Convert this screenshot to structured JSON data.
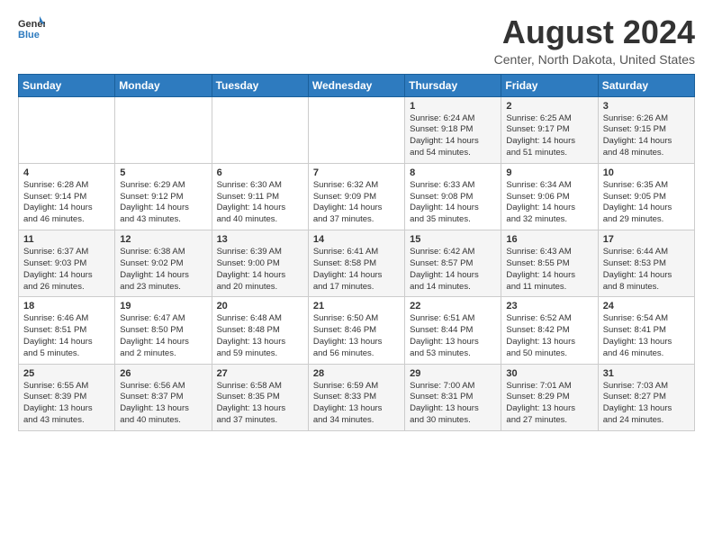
{
  "header": {
    "logo_general": "General",
    "logo_blue": "Blue",
    "month_year": "August 2024",
    "location": "Center, North Dakota, United States"
  },
  "days_of_week": [
    "Sunday",
    "Monday",
    "Tuesday",
    "Wednesday",
    "Thursday",
    "Friday",
    "Saturday"
  ],
  "weeks": [
    [
      {
        "day": "",
        "content": ""
      },
      {
        "day": "",
        "content": ""
      },
      {
        "day": "",
        "content": ""
      },
      {
        "day": "",
        "content": ""
      },
      {
        "day": "1",
        "content": "Sunrise: 6:24 AM\nSunset: 9:18 PM\nDaylight: 14 hours\nand 54 minutes."
      },
      {
        "day": "2",
        "content": "Sunrise: 6:25 AM\nSunset: 9:17 PM\nDaylight: 14 hours\nand 51 minutes."
      },
      {
        "day": "3",
        "content": "Sunrise: 6:26 AM\nSunset: 9:15 PM\nDaylight: 14 hours\nand 48 minutes."
      }
    ],
    [
      {
        "day": "4",
        "content": "Sunrise: 6:28 AM\nSunset: 9:14 PM\nDaylight: 14 hours\nand 46 minutes."
      },
      {
        "day": "5",
        "content": "Sunrise: 6:29 AM\nSunset: 9:12 PM\nDaylight: 14 hours\nand 43 minutes."
      },
      {
        "day": "6",
        "content": "Sunrise: 6:30 AM\nSunset: 9:11 PM\nDaylight: 14 hours\nand 40 minutes."
      },
      {
        "day": "7",
        "content": "Sunrise: 6:32 AM\nSunset: 9:09 PM\nDaylight: 14 hours\nand 37 minutes."
      },
      {
        "day": "8",
        "content": "Sunrise: 6:33 AM\nSunset: 9:08 PM\nDaylight: 14 hours\nand 35 minutes."
      },
      {
        "day": "9",
        "content": "Sunrise: 6:34 AM\nSunset: 9:06 PM\nDaylight: 14 hours\nand 32 minutes."
      },
      {
        "day": "10",
        "content": "Sunrise: 6:35 AM\nSunset: 9:05 PM\nDaylight: 14 hours\nand 29 minutes."
      }
    ],
    [
      {
        "day": "11",
        "content": "Sunrise: 6:37 AM\nSunset: 9:03 PM\nDaylight: 14 hours\nand 26 minutes."
      },
      {
        "day": "12",
        "content": "Sunrise: 6:38 AM\nSunset: 9:02 PM\nDaylight: 14 hours\nand 23 minutes."
      },
      {
        "day": "13",
        "content": "Sunrise: 6:39 AM\nSunset: 9:00 PM\nDaylight: 14 hours\nand 20 minutes."
      },
      {
        "day": "14",
        "content": "Sunrise: 6:41 AM\nSunset: 8:58 PM\nDaylight: 14 hours\nand 17 minutes."
      },
      {
        "day": "15",
        "content": "Sunrise: 6:42 AM\nSunset: 8:57 PM\nDaylight: 14 hours\nand 14 minutes."
      },
      {
        "day": "16",
        "content": "Sunrise: 6:43 AM\nSunset: 8:55 PM\nDaylight: 14 hours\nand 11 minutes."
      },
      {
        "day": "17",
        "content": "Sunrise: 6:44 AM\nSunset: 8:53 PM\nDaylight: 14 hours\nand 8 minutes."
      }
    ],
    [
      {
        "day": "18",
        "content": "Sunrise: 6:46 AM\nSunset: 8:51 PM\nDaylight: 14 hours\nand 5 minutes."
      },
      {
        "day": "19",
        "content": "Sunrise: 6:47 AM\nSunset: 8:50 PM\nDaylight: 14 hours\nand 2 minutes."
      },
      {
        "day": "20",
        "content": "Sunrise: 6:48 AM\nSunset: 8:48 PM\nDaylight: 13 hours\nand 59 minutes."
      },
      {
        "day": "21",
        "content": "Sunrise: 6:50 AM\nSunset: 8:46 PM\nDaylight: 13 hours\nand 56 minutes."
      },
      {
        "day": "22",
        "content": "Sunrise: 6:51 AM\nSunset: 8:44 PM\nDaylight: 13 hours\nand 53 minutes."
      },
      {
        "day": "23",
        "content": "Sunrise: 6:52 AM\nSunset: 8:42 PM\nDaylight: 13 hours\nand 50 minutes."
      },
      {
        "day": "24",
        "content": "Sunrise: 6:54 AM\nSunset: 8:41 PM\nDaylight: 13 hours\nand 46 minutes."
      }
    ],
    [
      {
        "day": "25",
        "content": "Sunrise: 6:55 AM\nSunset: 8:39 PM\nDaylight: 13 hours\nand 43 minutes."
      },
      {
        "day": "26",
        "content": "Sunrise: 6:56 AM\nSunset: 8:37 PM\nDaylight: 13 hours\nand 40 minutes."
      },
      {
        "day": "27",
        "content": "Sunrise: 6:58 AM\nSunset: 8:35 PM\nDaylight: 13 hours\nand 37 minutes."
      },
      {
        "day": "28",
        "content": "Sunrise: 6:59 AM\nSunset: 8:33 PM\nDaylight: 13 hours\nand 34 minutes."
      },
      {
        "day": "29",
        "content": "Sunrise: 7:00 AM\nSunset: 8:31 PM\nDaylight: 13 hours\nand 30 minutes."
      },
      {
        "day": "30",
        "content": "Sunrise: 7:01 AM\nSunset: 8:29 PM\nDaylight: 13 hours\nand 27 minutes."
      },
      {
        "day": "31",
        "content": "Sunrise: 7:03 AM\nSunset: 8:27 PM\nDaylight: 13 hours\nand 24 minutes."
      }
    ]
  ]
}
